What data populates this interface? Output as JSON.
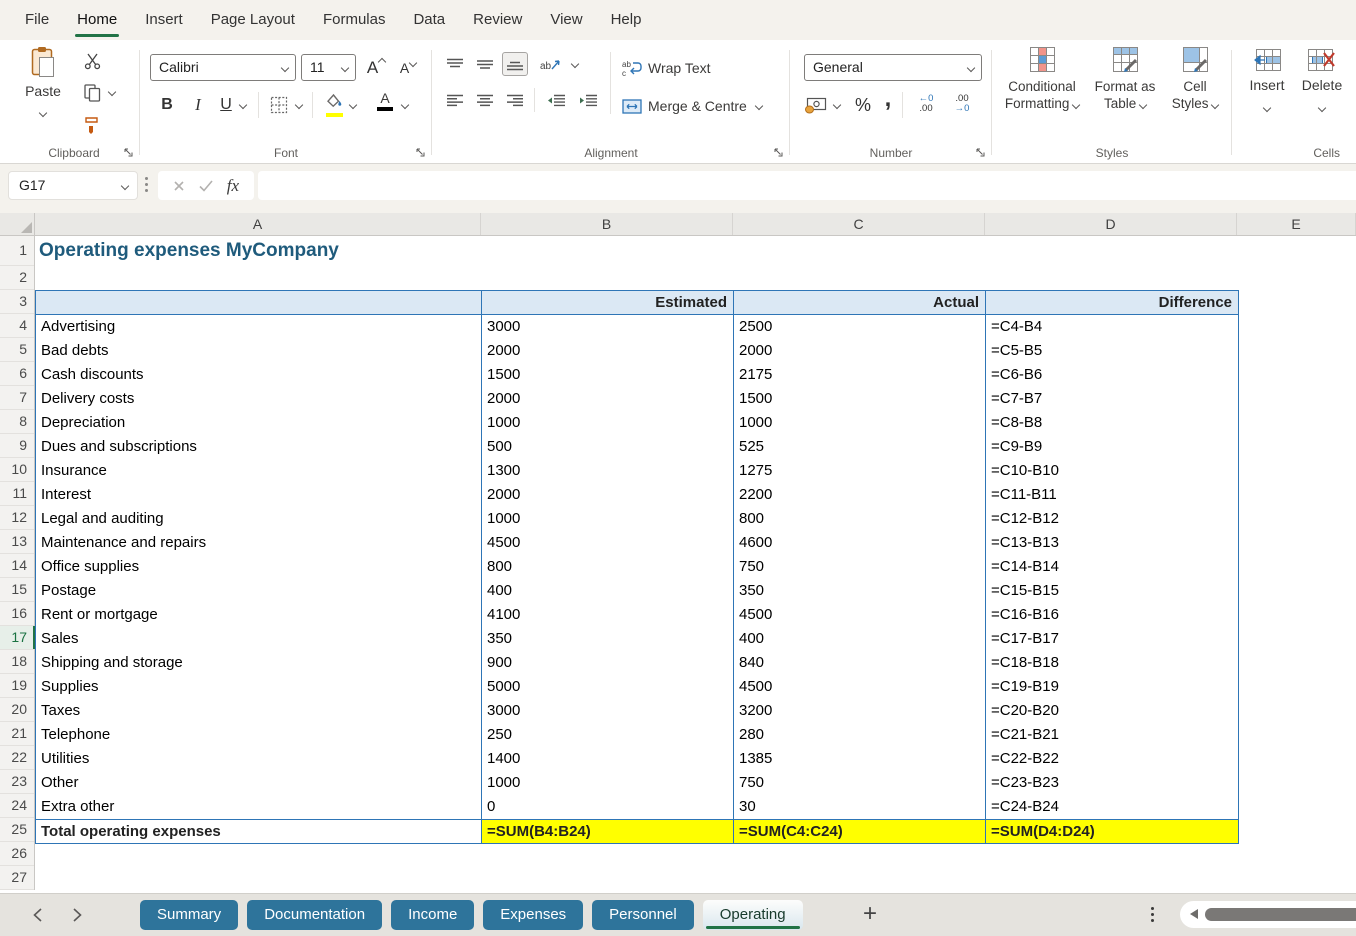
{
  "app": {
    "menu_tabs": [
      "File",
      "Home",
      "Insert",
      "Page Layout",
      "Formulas",
      "Data",
      "Review",
      "View",
      "Help"
    ],
    "active_menu_tab": "Home"
  },
  "ribbon": {
    "clipboard": {
      "group_label": "Clipboard",
      "paste_label": "Paste"
    },
    "font": {
      "group_label": "Font",
      "font_name": "Calibri",
      "font_size": "11",
      "bold": "B",
      "italic": "I",
      "underline": "U"
    },
    "alignment": {
      "group_label": "Alignment",
      "wrap_text_label": "Wrap Text",
      "merge_label": "Merge & Centre"
    },
    "number": {
      "group_label": "Number",
      "format": "General",
      "percent": "%",
      "comma": ","
    },
    "styles": {
      "group_label": "Styles",
      "conditional_line1": "Conditional",
      "conditional_line2": "Formatting",
      "format_table_line1": "Format as",
      "format_table_line2": "Table",
      "cell_styles_line1": "Cell",
      "cell_styles_line2": "Styles"
    },
    "cells": {
      "group_label": "Cells",
      "insert_label": "Insert",
      "delete_label": "Delete"
    }
  },
  "formula_bar": {
    "name_box": "G17",
    "fx": "fx",
    "formula_value": ""
  },
  "sheet": {
    "columns": [
      "A",
      "B",
      "C",
      "D",
      "E"
    ],
    "row_count": 27,
    "selected_row": 17,
    "selected_cell": "G17",
    "title": "Operating expenses MyCompany",
    "header": {
      "estimated": "Estimated",
      "actual": "Actual",
      "difference": "Difference"
    },
    "rows": [
      {
        "row": 4,
        "label": "Advertising",
        "estimated": "3000",
        "actual": "2500",
        "difference": "=C4-B4"
      },
      {
        "row": 5,
        "label": "Bad debts",
        "estimated": "2000",
        "actual": "2000",
        "difference": "=C5-B5"
      },
      {
        "row": 6,
        "label": "Cash discounts",
        "estimated": "1500",
        "actual": "2175",
        "difference": "=C6-B6"
      },
      {
        "row": 7,
        "label": "Delivery costs",
        "estimated": "2000",
        "actual": "1500",
        "difference": "=C7-B7"
      },
      {
        "row": 8,
        "label": "Depreciation",
        "estimated": "1000",
        "actual": "1000",
        "difference": "=C8-B8"
      },
      {
        "row": 9,
        "label": "Dues and subscriptions",
        "estimated": "500",
        "actual": "525",
        "difference": "=C9-B9"
      },
      {
        "row": 10,
        "label": "Insurance",
        "estimated": "1300",
        "actual": "1275",
        "difference": "=C10-B10"
      },
      {
        "row": 11,
        "label": "Interest",
        "estimated": "2000",
        "actual": "2200",
        "difference": "=C11-B11"
      },
      {
        "row": 12,
        "label": "Legal and auditing",
        "estimated": "1000",
        "actual": "800",
        "difference": "=C12-B12"
      },
      {
        "row": 13,
        "label": "Maintenance and repairs",
        "estimated": "4500",
        "actual": "4600",
        "difference": "=C13-B13"
      },
      {
        "row": 14,
        "label": "Office supplies",
        "estimated": "800",
        "actual": "750",
        "difference": "=C14-B14"
      },
      {
        "row": 15,
        "label": "Postage",
        "estimated": "400",
        "actual": "350",
        "difference": "=C15-B15"
      },
      {
        "row": 16,
        "label": "Rent or mortgage",
        "estimated": "4100",
        "actual": "4500",
        "difference": "=C16-B16"
      },
      {
        "row": 17,
        "label": "Sales",
        "estimated": "350",
        "actual": "400",
        "difference": "=C17-B17"
      },
      {
        "row": 18,
        "label": "Shipping and storage",
        "estimated": "900",
        "actual": "840",
        "difference": "=C18-B18"
      },
      {
        "row": 19,
        "label": "Supplies",
        "estimated": "5000",
        "actual": "4500",
        "difference": "=C19-B19"
      },
      {
        "row": 20,
        "label": "Taxes",
        "estimated": "3000",
        "actual": "3200",
        "difference": "=C20-B20"
      },
      {
        "row": 21,
        "label": "Telephone",
        "estimated": "250",
        "actual": "280",
        "difference": "=C21-B21"
      },
      {
        "row": 22,
        "label": "Utilities",
        "estimated": "1400",
        "actual": "1385",
        "difference": "=C22-B22"
      },
      {
        "row": 23,
        "label": "Other",
        "estimated": "1000",
        "actual": "750",
        "difference": "=C23-B23"
      },
      {
        "row": 24,
        "label": "Extra other",
        "estimated": "0",
        "actual": "30",
        "difference": "=C24-B24"
      }
    ],
    "total_row": {
      "row": 25,
      "label": "Total operating expenses",
      "estimated": "=SUM(B4:B24)",
      "actual": "=SUM(C4:C24)",
      "difference": "=SUM(D4:D24)"
    }
  },
  "sheet_tabs": {
    "tabs": [
      "Summary",
      "Documentation",
      "Income",
      "Expenses",
      "Personnel",
      "Operating"
    ],
    "active_tab": "Operating",
    "add_label": "+"
  },
  "colors": {
    "active_green": "#217346",
    "tab_blue": "#2E749B",
    "table_border": "#2E75B6",
    "header_fill": "#DBE8F4",
    "total_fill": "#FFFF00",
    "title_text": "#1F5B7C"
  }
}
